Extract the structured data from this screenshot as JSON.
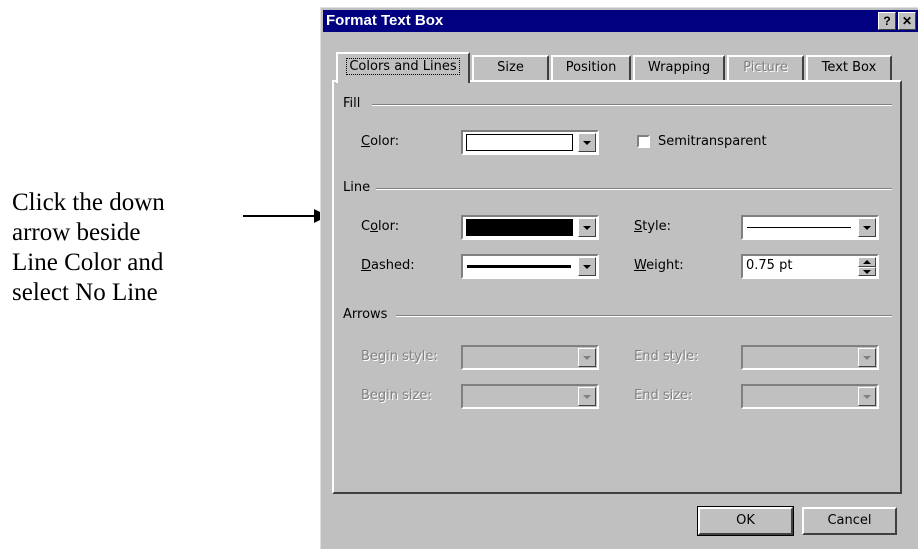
{
  "annotation": {
    "lines": [
      "Click the down",
      "arrow beside",
      "Line Color and",
      "select No Line"
    ]
  },
  "dialog": {
    "title": "Format Text Box",
    "help_glyph": "?",
    "close_glyph": "✕",
    "tabs": [
      {
        "label": "Colors and Lines",
        "active": true
      },
      {
        "label": "Size"
      },
      {
        "label": "Position"
      },
      {
        "label": "Wrapping"
      },
      {
        "label": "Picture",
        "disabled": true
      },
      {
        "label": "Text Box"
      }
    ],
    "fill": {
      "group_label": "Fill",
      "color_label": "Color:",
      "color_value": "#ffffff",
      "semitransparent_label": "Semitransparent",
      "semitransparent_checked": false
    },
    "line": {
      "group_label": "Line",
      "color_label": "Color:",
      "color_value": "#000000",
      "style_label": "Style:",
      "dashed_label": "Dashed:",
      "weight_label": "Weight:",
      "weight_value": "0.75 pt"
    },
    "arrows": {
      "group_label": "Arrows",
      "begin_style_label": "Begin style:",
      "end_style_label": "End style:",
      "begin_size_label": "Begin size:",
      "end_size_label": "End size:"
    },
    "buttons": {
      "ok": "OK",
      "cancel": "Cancel"
    }
  }
}
